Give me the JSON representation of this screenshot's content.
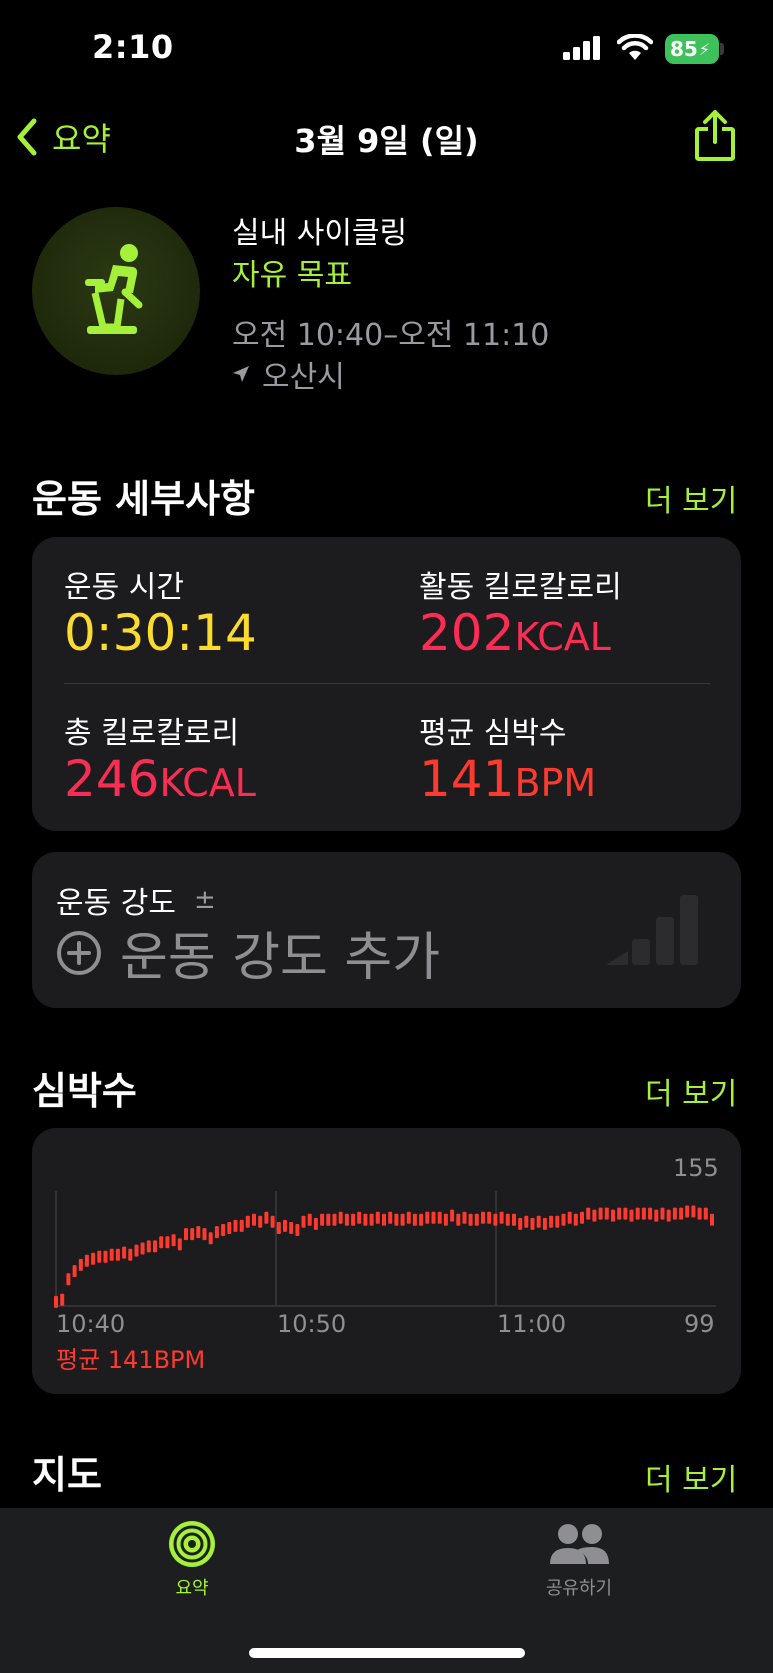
{
  "status_bar": {
    "time": "2:10",
    "battery": "85"
  },
  "nav": {
    "back_label": "요약",
    "title": "3월 9일 (일)"
  },
  "workout": {
    "type": "실내 사이클링",
    "goal": "자유 목표",
    "time_range": "오전 10:40–오전 11:10",
    "location": "오산시",
    "icon": "indoor-cycle-icon"
  },
  "details": {
    "title": "운동 세부사항",
    "more": "더 보기",
    "metrics": [
      {
        "label": "운동 시간",
        "value": "0:30:14",
        "unit": ""
      },
      {
        "label": "활동 킬로칼로리",
        "value": "202",
        "unit": "KCAL"
      },
      {
        "label": "총 킬로칼로리",
        "value": "246",
        "unit": "KCAL"
      },
      {
        "label": "평균 심박수",
        "value": "141",
        "unit": "BPM"
      }
    ]
  },
  "intensity": {
    "label": "운동 강도",
    "pm": "±",
    "add_label": "운동 강도 추가"
  },
  "heart_rate": {
    "title": "심박수",
    "more": "더 보기",
    "max_label": "155",
    "min_label": "99",
    "x_labels": [
      "10:40",
      "10:50",
      "11:00"
    ],
    "avg_label": "평균 141BPM"
  },
  "chart_data": {
    "type": "scatter",
    "ylim": [
      99,
      155
    ],
    "x_ticks": [
      "10:40",
      "10:50",
      "11:00"
    ],
    "series": [
      {
        "values": [
          101,
          102,
          112,
          116,
          119,
          121,
          122,
          123,
          123,
          124,
          124,
          125,
          124,
          126,
          127,
          128,
          128,
          130,
          130,
          131,
          129,
          134,
          134,
          135,
          134,
          132,
          135,
          136,
          137,
          138,
          138,
          140,
          141,
          140,
          142,
          140,
          137,
          138,
          137,
          136,
          140,
          141,
          139,
          141,
          141,
          141,
          142,
          141,
          141,
          142,
          141,
          141,
          142,
          141,
          142,
          141,
          141,
          142,
          141,
          141,
          142,
          142,
          142,
          141,
          143,
          141,
          142,
          141,
          141,
          142,
          142,
          141,
          142,
          141,
          141,
          139,
          140,
          139,
          140,
          139,
          140,
          140,
          141,
          142,
          141,
          142,
          144,
          143,
          144,
          144,
          143,
          144,
          144,
          143,
          144,
          144,
          144,
          143,
          144,
          143,
          144,
          144,
          145,
          145,
          144,
          144,
          141
        ]
      }
    ]
  },
  "map_section": {
    "title": "지도",
    "more": "더 보기"
  },
  "tabs": [
    {
      "label": "요약",
      "icon": "activity-rings-icon",
      "color": "#a5f13a"
    },
    {
      "label": "공유하기",
      "icon": "people-icon",
      "color": "#8e8e93"
    }
  ],
  "colors": {
    "accent": "#a5f13a",
    "yellow": "#fcdb2f",
    "red": "#fb2d55",
    "heart": "#fe3a2e"
  }
}
